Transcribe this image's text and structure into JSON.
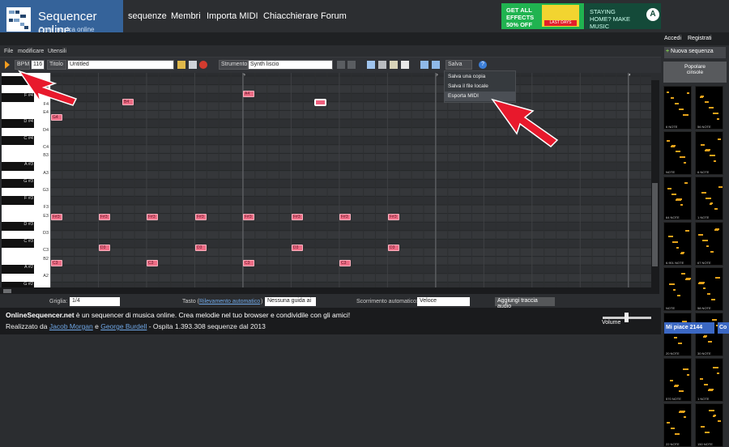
{
  "brand": {
    "title": "Sequencer online",
    "subtitle": "Crea musica online"
  },
  "nav": [
    "sequenze",
    "Membri",
    "Importa MIDI",
    "Chiacchierare",
    "Forum"
  ],
  "ad": {
    "left": "GET ALL EFFECTS 50% OFF",
    "badge": "LAST DAYS",
    "right": "STAYING HOME? MAKE MUSIC"
  },
  "auth": {
    "login": "Accedi",
    "register": "Registrati"
  },
  "menu": [
    "File",
    "modificare",
    "Utensili"
  ],
  "toolbar": {
    "bpm_label": "BPM",
    "bpm_value": "116",
    "title_label": "Titolo",
    "title_value": "Untitled",
    "instrument_label": "Strumento",
    "instrument_value": "Synth liscio",
    "save_label": "Salva"
  },
  "save_menu": [
    "Salva una copia",
    "Salva il file locale",
    "Esporta MIDI"
  ],
  "ruler": [
    "2",
    "3",
    "4"
  ],
  "piano_keys": [
    "G#4",
    "G4",
    "F#4",
    "F4",
    "E4",
    "D#4",
    "D4",
    "C#4",
    "C4",
    "B3",
    "A#3",
    "A3",
    "G#3",
    "G3",
    "F#3",
    "F3",
    "E3",
    "D#3",
    "D3",
    "C#3",
    "C3",
    "B2",
    "A#2",
    "A2",
    "G#2"
  ],
  "notes": [
    {
      "label": "G4"
    },
    {
      "label": "B4"
    },
    {
      "label": "A4"
    },
    {
      "label": "F#3"
    },
    {
      "label": "D3"
    },
    {
      "label": "C3"
    }
  ],
  "bottom": {
    "grid_label": "Griglia:",
    "grid_value": "1/4",
    "key_label": "Tasto (",
    "key_link": "Rilevamento automatico",
    "key_close": ")",
    "key_value": "Nessuna guida ai",
    "scroll_label": "Scorrimento automatico:",
    "scroll_value": "Veloce",
    "add_track": "Aggiungi traccia audio"
  },
  "footer": {
    "site": "OnlineSequencer.net",
    "line1": " è un sequencer di musica online. Crea melodie nel tuo browser e condividile con gli amici!",
    "line2_prefix": "Realizzato da ",
    "author1": "Jacob Morgan",
    "and": " e ",
    "author2": "George Burdell",
    "line2_suffix": " - Ospita 1.393.308 sequenze dal 2013",
    "volume": "Volume"
  },
  "sidebar": {
    "new_sequence": "Nuova sequenza",
    "popular": "Popolare",
    "popular_sub": "cinsole",
    "thumbnails": [
      "6 NOTE",
      "56 NOTE",
      "NOTE",
      "6 NOTE",
      "64 NOTE",
      "1 NOTE",
      "6.901 NOTE",
      "67 NOTE",
      "NOTE",
      "58 NOTE",
      "20 NOTE",
      "30 NOTE",
      "570 NOTE",
      "1 NOTE",
      "22 NOTE",
      "150 NOTE"
    ]
  },
  "social": {
    "like": "Mi piace 2144",
    "c": "Co"
  },
  "colors": {
    "brand": "#35639a",
    "note": "#ee6c85",
    "accent_arrow": "#e8192c"
  }
}
